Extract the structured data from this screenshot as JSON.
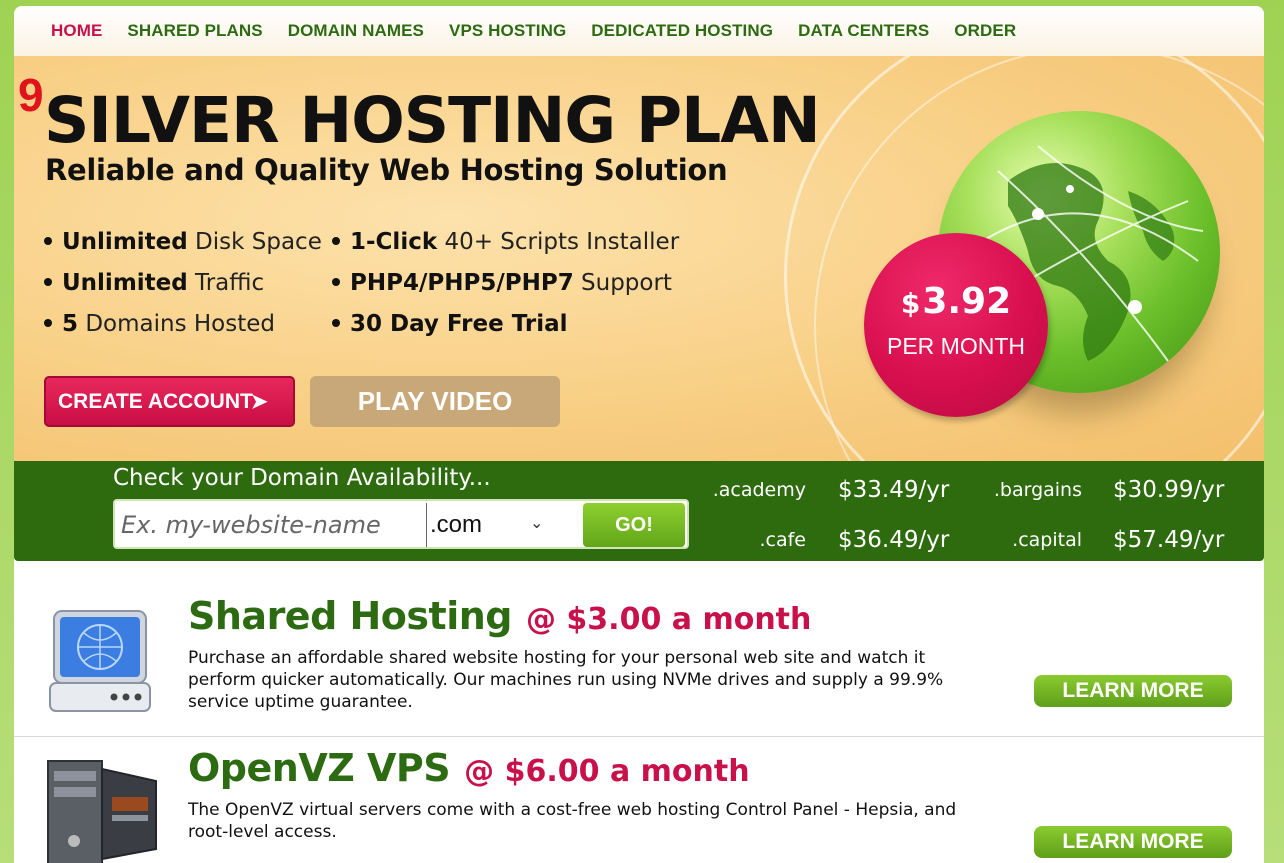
{
  "nav": {
    "items": [
      {
        "label": "HOME",
        "active": true
      },
      {
        "label": "SHARED PLANS"
      },
      {
        "label": "DOMAIN NAMES"
      },
      {
        "label": "VPS HOSTING"
      },
      {
        "label": "DEDICATED HOSTING"
      },
      {
        "label": "DATA CENTERS"
      },
      {
        "label": "ORDER"
      }
    ]
  },
  "hero": {
    "badge": "9",
    "title": "SILVER HOSTING PLAN",
    "subtitle": "Reliable and Quality Web Hosting Solution",
    "features": [
      {
        "bold": "Unlimited",
        "rest": " Disk Space"
      },
      {
        "bold": "Unlimited",
        "rest": " Traffic"
      },
      {
        "bold": "5",
        "rest": " Domains Hosted"
      },
      {
        "bold": "1-Click",
        "rest": " 40+ Scripts Installer"
      },
      {
        "bold": "PHP4/PHP5/PHP7",
        "rest": " Support"
      },
      {
        "bold": "30 Day Free Trial",
        "rest": ""
      }
    ],
    "create_label": "CREATE ACCOUNT",
    "video_label": "PLAY VIDEO",
    "price_currency": "$",
    "price_amount": "3.92",
    "price_period": "PER MONTH"
  },
  "domain": {
    "title": "Check your Domain Availability...",
    "placeholder": "Ex. my-website-name",
    "tld_selected": ".com",
    "go_label": "GO!",
    "prices": [
      {
        "tld": ".academy",
        "price": "$33.49/yr"
      },
      {
        "tld": ".bargains",
        "price": "$30.99/yr"
      },
      {
        "tld": ".cafe",
        "price": "$36.49/yr"
      },
      {
        "tld": ".capital",
        "price": "$57.49/yr"
      }
    ]
  },
  "products": [
    {
      "name": "Shared Hosting",
      "price": "@ $3.00 a month",
      "desc": "Purchase an affordable shared website hosting for your personal web site and watch it perform quicker automatically. Our machines run using NVMe drives and supply a 99.9% service uptime guarantee.",
      "button": "LEARN MORE"
    },
    {
      "name": "OpenVZ VPS",
      "price": "@ $6.00 a month",
      "desc": "The OpenVZ virtual servers come with a cost-free web hosting Control Panel - Hepsia, and root-level access.",
      "button": "LEARN MORE"
    }
  ],
  "colors": {
    "nav_green": "#2d6b12",
    "accent_pink": "#c8104a",
    "domain_bar": "#2e6b0e"
  }
}
